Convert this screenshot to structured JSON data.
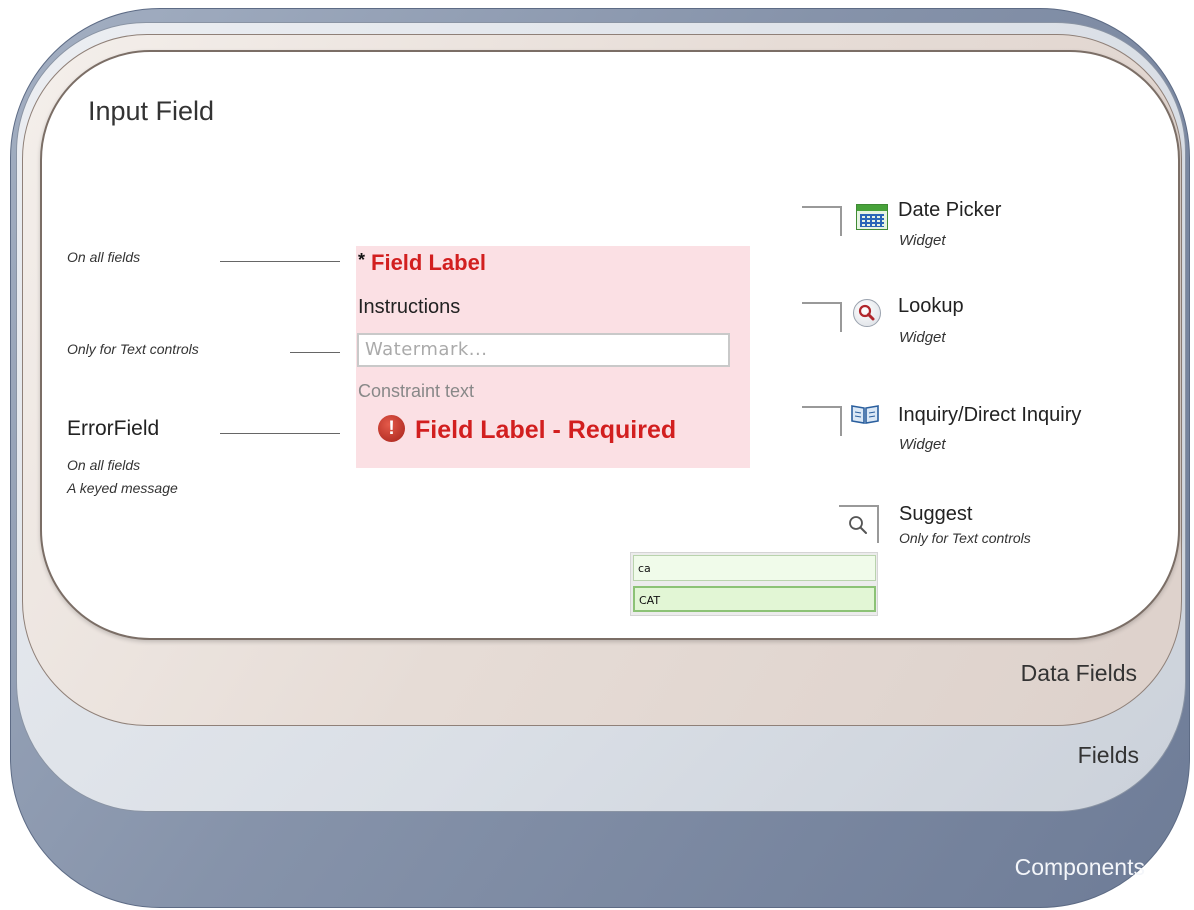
{
  "layers": {
    "components": "Components",
    "fields": "Fields",
    "data_fields": "Data Fields",
    "input_field": "Input Field"
  },
  "annotations": {
    "on_all_fields_1": "On all fields",
    "only_text_controls": "Only for Text controls",
    "error_field_title": "ErrorField",
    "on_all_fields_2": "On all fields",
    "keyed_message": "A keyed message"
  },
  "field": {
    "required_marker": "*",
    "label": "Field Label",
    "instructions": "Instructions",
    "watermark": "Watermark...",
    "constraint": "Constraint text",
    "error_icon_glyph": "!",
    "error_text": "Field Label - Required"
  },
  "widgets": {
    "date_picker": {
      "title": "Date Picker",
      "subtitle": "Widget",
      "icon": "calendar-icon"
    },
    "lookup": {
      "title": "Lookup",
      "subtitle": "Widget",
      "icon": "magnifier-icon"
    },
    "inquiry": {
      "title": "Inquiry/Direct Inquiry",
      "subtitle": "Widget",
      "icon": "book-icon"
    },
    "suggest": {
      "title": "Suggest",
      "subtitle": "Only for Text controls",
      "icon": "search-icon"
    }
  },
  "suggest_dropdown": {
    "input_value": "ca",
    "option": "CAT"
  },
  "colors": {
    "error_red": "#d21f1f",
    "field_panel_bg": "#fbe0e4",
    "components_layer": "#8693aa"
  }
}
